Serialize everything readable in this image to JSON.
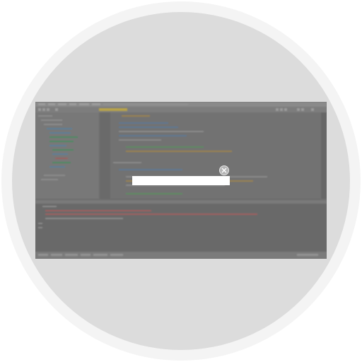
{
  "overlay": {
    "input_value": "",
    "input_placeholder": "",
    "close_icon": "close-icon"
  },
  "background_screenshot": {
    "description_hidden": true,
    "colors": {
      "outer_ring": "#f4f4f4",
      "circle": "#dcdcdc",
      "screenshot_dim": "#6e6e6e",
      "input_bar": "#ffffff"
    }
  }
}
